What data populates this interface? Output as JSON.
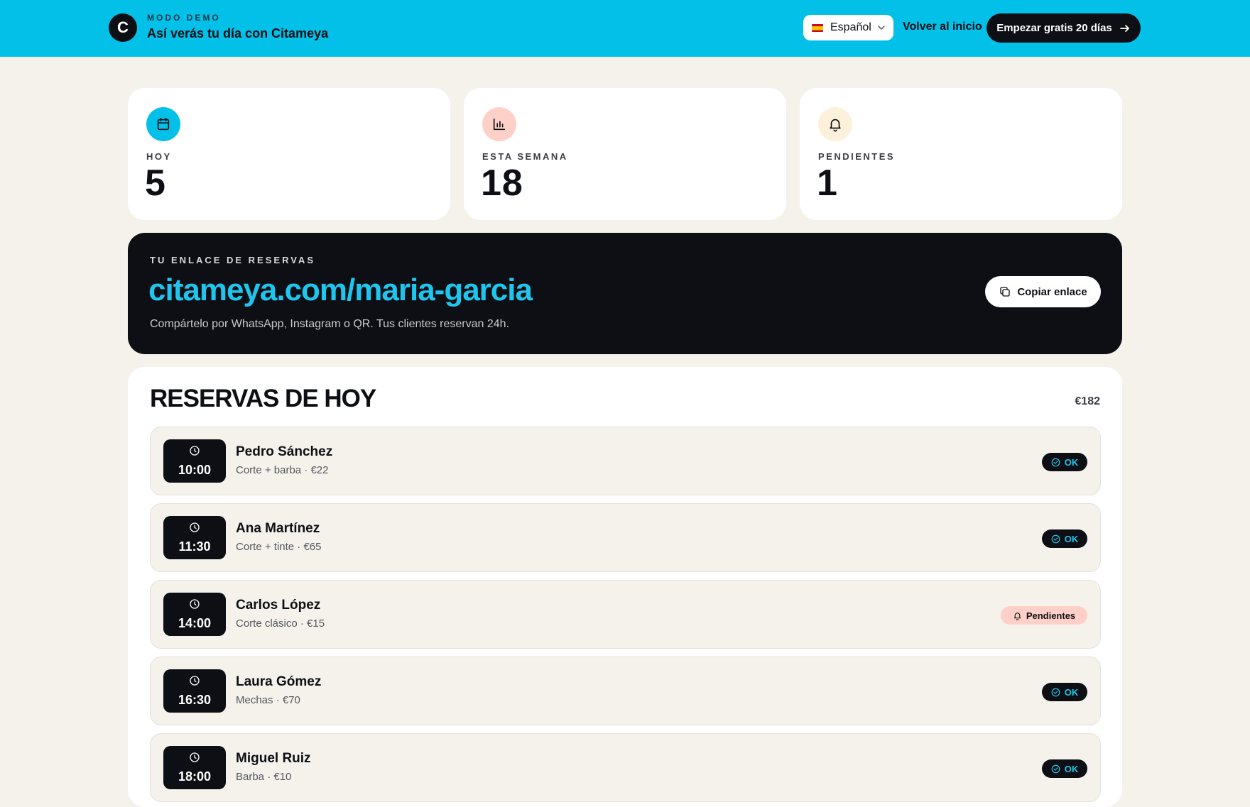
{
  "header": {
    "logo_letter": "C",
    "demo_tag": "MODO DEMO",
    "demo_title": "Así verás tu día con Citameya",
    "language": "Español",
    "back_link": "Volver al inicio",
    "cta": "Empezar gratis 20 días",
    "brand_color": "#02c0e8"
  },
  "stats": [
    {
      "label": "HOY",
      "value": "5",
      "icon": "calendar-icon",
      "icon_bg": "#02c0e8"
    },
    {
      "label": "ESTA SEMANA",
      "value": "18",
      "icon": "bar-chart-icon",
      "icon_bg": "#ffd0c8"
    },
    {
      "label": "PENDIENTES",
      "value": "1",
      "icon": "bell-icon",
      "icon_bg": "#fdf1dc"
    }
  ],
  "booking_link": {
    "title": "TU ENLACE DE RESERVAS",
    "url": "citameya.com/maria-garcia",
    "description": "Compártelo por WhatsApp, Instagram o QR. Tus clientes reservan 24h.",
    "copy_label": "Copiar enlace"
  },
  "reservations": {
    "title": "RESERVAS DE HOY",
    "total": "€182",
    "items": [
      {
        "time": "10:00",
        "name": "Pedro Sánchez",
        "service": "Corte + barba · €22",
        "status": "OK"
      },
      {
        "time": "11:30",
        "name": "Ana Martínez",
        "service": "Corte + tinte · €65",
        "status": "OK"
      },
      {
        "time": "14:00",
        "name": "Carlos López",
        "service": "Corte clásico · €15",
        "status": "Pendientes"
      },
      {
        "time": "16:30",
        "name": "Laura Gómez",
        "service": "Mechas · €70",
        "status": "OK"
      },
      {
        "time": "18:00",
        "name": "Miguel Ruiz",
        "service": "Barba · €10",
        "status": "OK"
      }
    ]
  }
}
